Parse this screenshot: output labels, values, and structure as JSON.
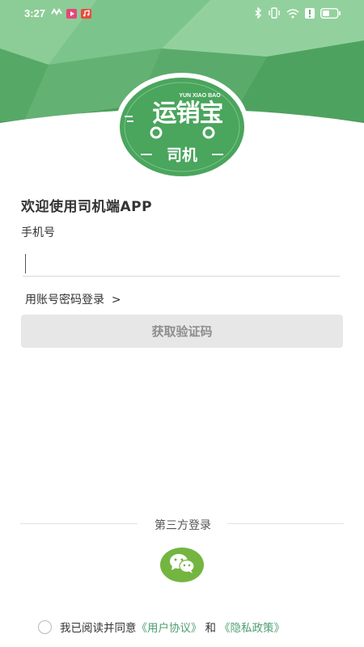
{
  "status_bar": {
    "time": "3:27",
    "left_icons": [
      "signal-wave-icon",
      "video-app-icon",
      "music-app-icon"
    ],
    "right_icons": [
      "bluetooth-icon",
      "vibrate-icon",
      "wifi-icon",
      "alert-icon",
      "battery-icon"
    ]
  },
  "logo": {
    "brand_name": "运销宝",
    "brand_pinyin": "YUN XIAO BAO",
    "role_label": "司机"
  },
  "login": {
    "welcome_title": "欢迎使用司机端APP",
    "phone_label": "手机号",
    "phone_value": "",
    "phone_placeholder": "",
    "account_login_link": "用账号密码登录  >",
    "get_code_button": "获取验证码"
  },
  "third_party": {
    "label": "第三方登录",
    "wechat_icon": "wechat-icon"
  },
  "agreement": {
    "prefix": "我已阅读并同意",
    "user_agreement": "《用户协议》",
    "conjunction": "和",
    "privacy_policy": "《隐私政策》"
  },
  "colors": {
    "brand_green": "#4aa55d",
    "wechat_green": "#74b541",
    "link_green": "#4e9e72",
    "button_gray": "#e7e7e7"
  }
}
